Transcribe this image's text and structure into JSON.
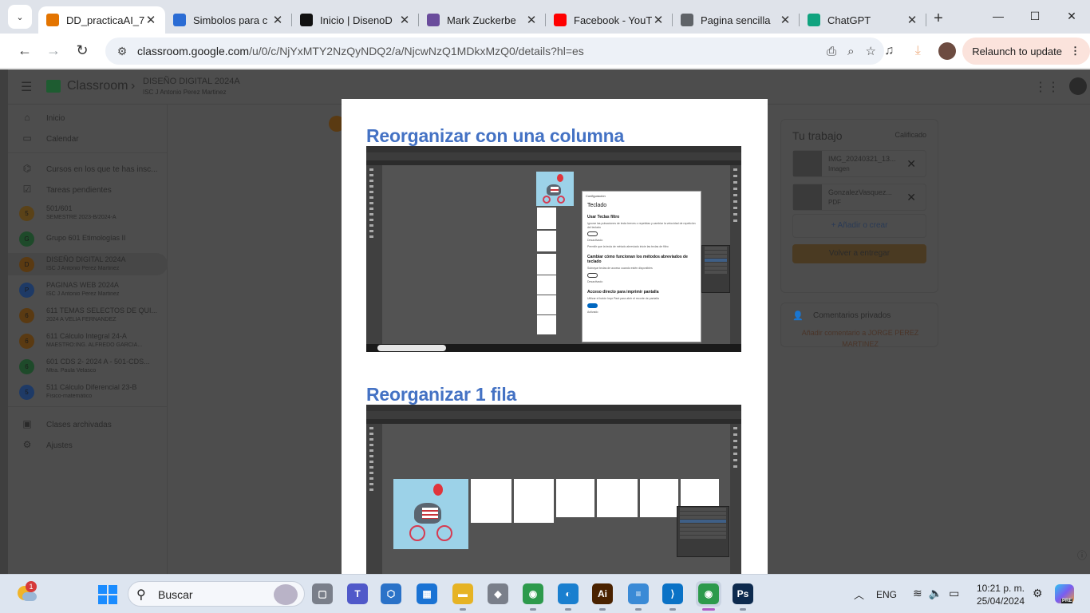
{
  "browser": {
    "tab_dropdown_icon": "chevron-down",
    "tabs": [
      {
        "title": "DD_practicaAI_7",
        "favicon": "classroom-assignment-icon",
        "color": "#e37400",
        "active": true
      },
      {
        "title": "Simbolos para c",
        "favicon": "az-icon",
        "color": "#2b6cd4",
        "active": false
      },
      {
        "title": "Inicio | DisenoD",
        "favicon": "wix-icon",
        "color": "#111111",
        "active": false
      },
      {
        "title": "Mark Zuckerbe",
        "favicon": "x-icon",
        "color": "#6a4c9c",
        "active": false
      },
      {
        "title": "Facebook - YouT",
        "favicon": "youtube-icon",
        "color": "#ff0000",
        "active": false
      },
      {
        "title": "Pagina sencilla",
        "favicon": "globe-icon",
        "color": "#5f6368",
        "active": false
      },
      {
        "title": "ChatGPT",
        "favicon": "chatgpt-icon",
        "color": "#10a37f",
        "active": false
      }
    ],
    "new_tab_icon": "+",
    "window_controls": {
      "minimize": "—",
      "maximize": "☐",
      "close": "✕"
    },
    "url_host": "classroom.google.com",
    "url_path": "/u/0/c/NjYxMTY2NzQyNDQ2/a/NjcwNzQ1MDkxMzQ0/details?hl=es",
    "relaunch_label": "Relaunch to update"
  },
  "classroom": {
    "brand": "Classroom",
    "course_title": "DISEÑO DIGITAL 2024A",
    "course_teacher": "ISC J Antonio Perez Martinez",
    "nav": [
      {
        "label": "Inicio",
        "icon": "home-icon"
      },
      {
        "label": "Calendar",
        "icon": "calendar-icon"
      },
      {
        "label": "Cursos en los que te has insc...",
        "icon": "school-icon"
      },
      {
        "label": "Tareas pendientes",
        "icon": "tasks-icon"
      }
    ],
    "courses": [
      {
        "initial": "5",
        "name": "501/601",
        "sub": "SEMESTRE 2023-B/2024-A",
        "color": "#5a4218"
      },
      {
        "initial": "G",
        "name": "Grupo 601 Etimologías II",
        "sub": "",
        "color": "#1e4a2a"
      },
      {
        "initial": "D",
        "name": "DISEÑO DIGITAL 2024A",
        "sub": "ISC J Antonio Perez Martinez",
        "color": "#5a3a12"
      },
      {
        "initial": "P",
        "name": "PAGINAS WEB 2024A",
        "sub": "ISC J Antonio Perez Martinez",
        "color": "#1e3a66"
      },
      {
        "initial": "6",
        "name": "611 TEMAS SELECTOS DE QUI...",
        "sub": "2024 A VELIA FERNANDEZ",
        "color": "#5a3a12"
      },
      {
        "initial": "6",
        "name": "611 Cálculo Integral 24-A",
        "sub": "MAESTRO:ING. ALFREDO GARCIA...",
        "color": "#5a3a12"
      },
      {
        "initial": "6",
        "name": "601 CDS 2- 2024 A - 501-CDS...",
        "sub": "Mtra. Paula Velasco",
        "color": "#1e4a2a"
      },
      {
        "initial": "5",
        "name": "511 Cálculo Diferencial 23-B",
        "sub": "Físico-matemático",
        "color": "#1e3a66"
      }
    ],
    "archived": "Clases archivadas",
    "settings": "Ajustes",
    "your_work": "Tu trabajo",
    "graded": "Calificado",
    "attachments": [
      {
        "name": "IMG_20240321_13...",
        "type": "Imagen"
      },
      {
        "name": "GonzalezVasquez...",
        "type": "PDF"
      }
    ],
    "add_create": "+ Añadir o crear",
    "turn_in_again": "Volver a entregar",
    "private_comments": "Comentarios privados",
    "add_comment_link": "Añadir comentario a JORGE PEREZ MARTINEZ"
  },
  "document": {
    "heading1": "Reorganizar con una columna",
    "heading2": "Reorganizar 1 fila",
    "dialog": {
      "window_title": "Configuración",
      "heading": "Teclado",
      "section1": "Usar Teclas filtro",
      "section1_text": "Ignorar las pulsaciones de tecla breves o repetidas y cambiar la velocidad de repetición del teclado",
      "toggle1": "Desactivado",
      "check_text": "Permitir que la tecla de método abreviado inicie las teclas de filtro",
      "section2": "Cambiar cómo funcionan los métodos abreviados de teclado",
      "section2_text": "Subrayar teclas de acceso cuando estén disponibles",
      "toggle2": "Desactivado",
      "section3": "Acceso directo para imprimir pantalla",
      "section3_text": "Utilizar el botón Impr Pant para abrir el recorte de pantalla",
      "toggle3": "Activado"
    }
  },
  "taskbar": {
    "weather_badge": "1",
    "search_label": "Buscar",
    "apps": [
      {
        "name": "file-manager-app",
        "glyph": "▢",
        "color": "#7a7f8a"
      },
      {
        "name": "teams-app",
        "glyph": "T",
        "color": "#5059c9"
      },
      {
        "name": "3d-viewer-app",
        "glyph": "⬡",
        "color": "#2a72c8"
      },
      {
        "name": "store-app",
        "glyph": "▦",
        "color": "#1a73d4"
      },
      {
        "name": "explorer-app",
        "glyph": "▬",
        "color": "#e6b324"
      },
      {
        "name": "roblox-app",
        "glyph": "◆",
        "color": "#7a7f8a"
      },
      {
        "name": "chrome-app",
        "glyph": "◉",
        "color": "#2d9a4c"
      },
      {
        "name": "edge-app",
        "glyph": "◐",
        "color": "#1a7fcf"
      },
      {
        "name": "illustrator-app",
        "glyph": "Ai",
        "color": "#4a2200"
      },
      {
        "name": "notepad-app",
        "glyph": "≡",
        "color": "#3a8ad6"
      },
      {
        "name": "vscode-app",
        "glyph": "⟩",
        "color": "#0a72c6"
      },
      {
        "name": "chrome-profile-app",
        "glyph": "◉",
        "color": "#2d9a4c"
      },
      {
        "name": "photoshop-app",
        "glyph": "Ps",
        "color": "#0d2a4e"
      }
    ],
    "lang": "ENG",
    "time": "10:21 p. m.",
    "date": "25/04/2024",
    "copilot_badge": "PRE"
  }
}
